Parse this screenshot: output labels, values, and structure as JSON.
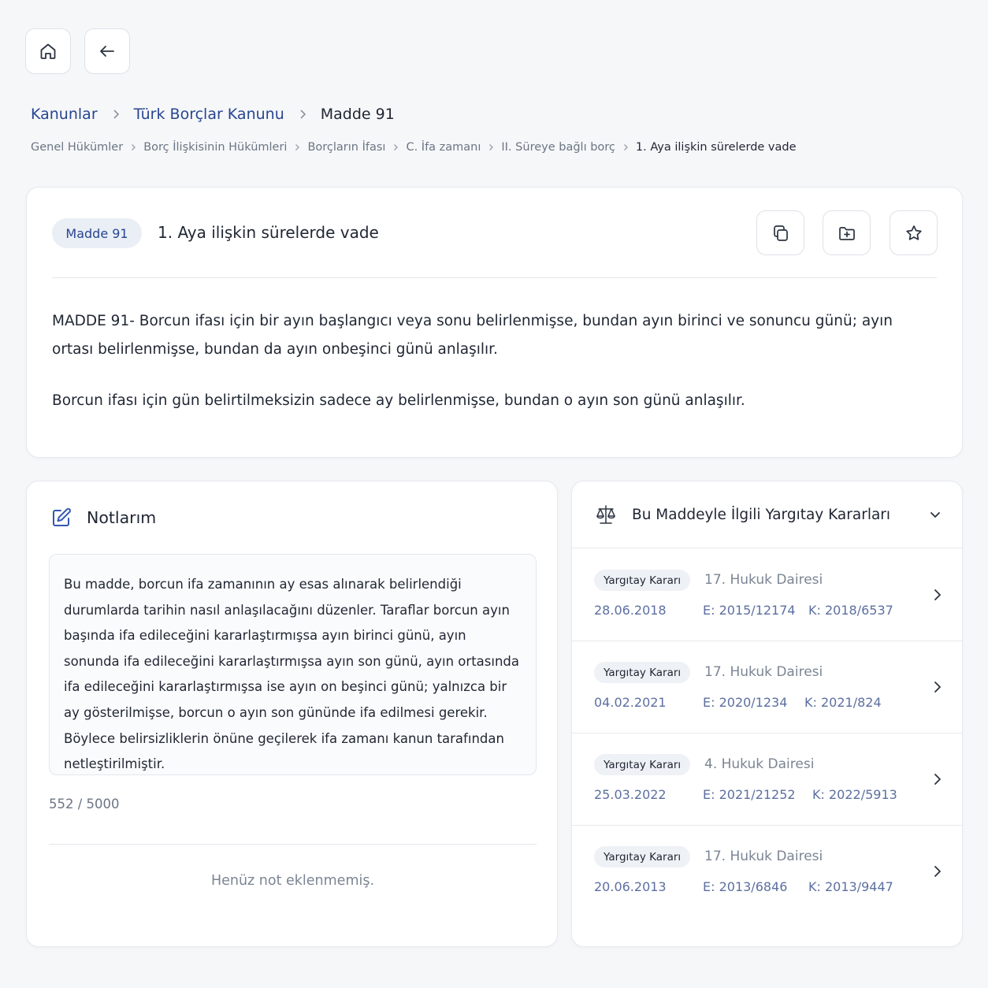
{
  "breadcrumb": {
    "items": [
      {
        "label": "Kanunlar"
      },
      {
        "label": "Türk Borçlar Kanunu"
      },
      {
        "label": "Madde 91"
      }
    ],
    "sub_items": [
      {
        "label": "Genel Hükümler"
      },
      {
        "label": "Borç İlişkisinin Hükümleri"
      },
      {
        "label": "Borçların İfası"
      },
      {
        "label": "C. İfa zamanı"
      },
      {
        "label": "II. Süreye bağlı borç"
      },
      {
        "label": "1. Aya ilişkin sürelerde vade"
      }
    ]
  },
  "article": {
    "badge": "Madde 91",
    "title": "1. Aya ilişkin sürelerde vade",
    "paragraphs": [
      "MADDE 91- Borcun ifası için bir ayın başlangıcı veya sonu belirlenmişse, bundan ayın birinci ve sonuncu günü; ayın ortası belirlenmişse, bundan da ayın onbeşinci günü anlaşılır.",
      "Borcun ifası için gün belirtilmeksizin sadece ay belirlenmişse, bundan o ayın son günü anlaşılır."
    ]
  },
  "notes": {
    "title": "Notlarım",
    "text": "Bu madde, borcun ifa zamanının ay esas alınarak belirlendiği durumlarda tarihin nasıl anlaşılacağını düzenler. Taraflar borcun ayın başında ifa edileceğini kararlaştırmışsa ayın birinci günü, ayın sonunda ifa edileceğini kararlaştırmışsa ayın son günü, ayın ortasında ifa edileceğini kararlaştırmışsa ise ayın on beşinci günü; yalnızca bir ay gösterilmişse, borcun o ayın son gününde ifa edilmesi gerekir. Böylece belirsizliklerin önüne geçilerek ifa zamanı kanun tarafından netleştirilmiştir.",
    "count": "552 / 5000",
    "empty": "Henüz not eklenmemiş."
  },
  "rulings": {
    "title": "Bu Maddeyle İlgili Yargıtay Kararları",
    "items": [
      {
        "badge": "Yargıtay Kararı",
        "court": "17. Hukuk Dairesi",
        "date": "28.06.2018",
        "e": "E: 2015/12174",
        "k": "K: 2018/6537"
      },
      {
        "badge": "Yargıtay Kararı",
        "court": "17. Hukuk Dairesi",
        "date": "04.02.2021",
        "e": "E: 2020/1234",
        "k": "K: 2021/824"
      },
      {
        "badge": "Yargıtay Kararı",
        "court": "4. Hukuk Dairesi",
        "date": "25.03.2022",
        "e": "E: 2021/21252",
        "k": "K: 2022/5913"
      },
      {
        "badge": "Yargıtay Kararı",
        "court": "17. Hukuk Dairesi",
        "date": "20.06.2013",
        "e": "E: 2013/6846",
        "k": "K: 2013/9447"
      }
    ]
  },
  "colors": {
    "accent": "#274690",
    "background": "#f6f7f9",
    "muted": "#6b7584"
  }
}
